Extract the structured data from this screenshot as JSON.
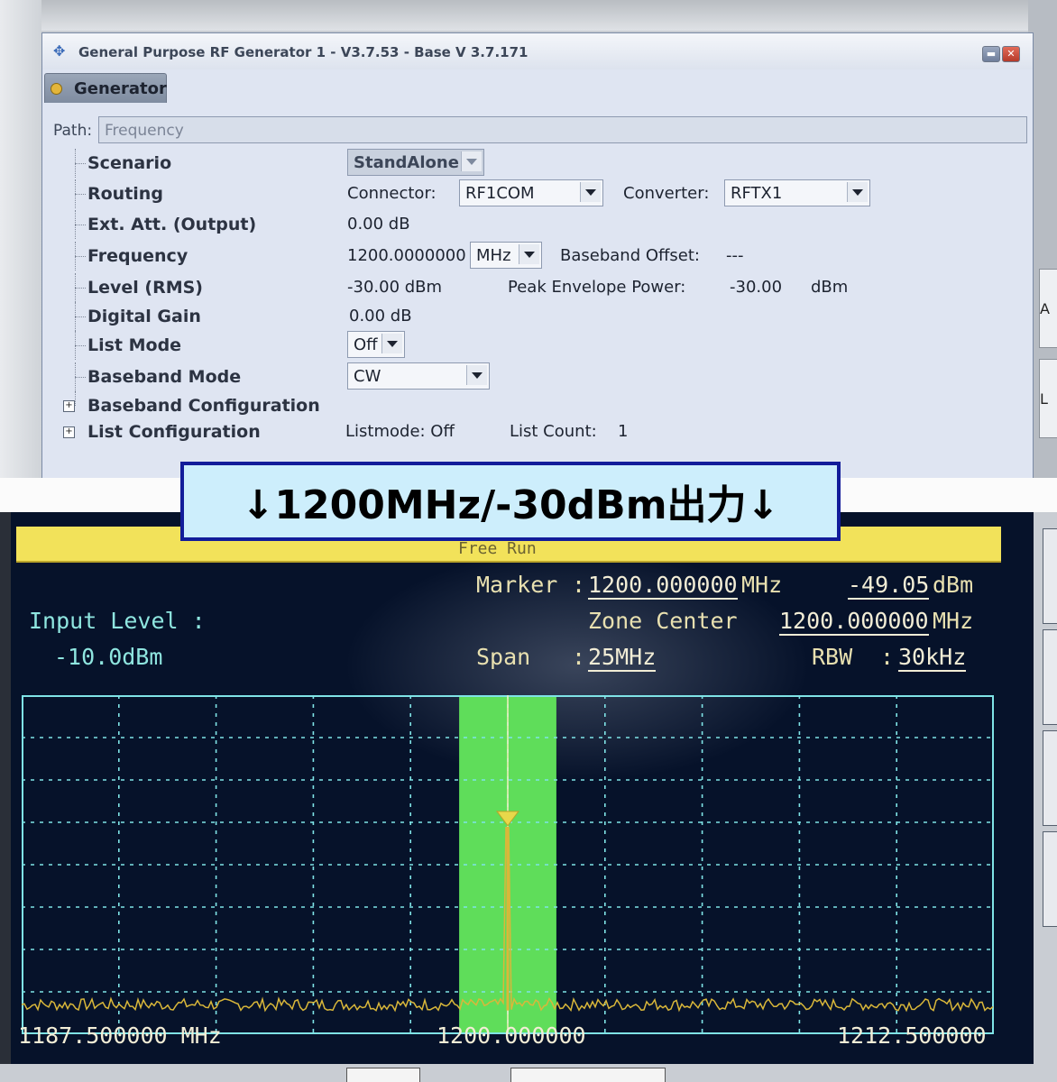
{
  "generator": {
    "window_title": "General Purpose RF Generator 1 - V3.7.53 - Base V 3.7.171",
    "tab_label": "Generator",
    "path_label": "Path:",
    "path_value": "Frequency",
    "rows": {
      "scenario": {
        "label": "Scenario",
        "value": "StandAlone"
      },
      "routing": {
        "label": "Routing",
        "connector_label": "Connector:",
        "connector_value": "RF1COM",
        "converter_label": "Converter:",
        "converter_value": "RFTX1"
      },
      "ext_att": {
        "label": "Ext. Att. (Output)",
        "value": "0.00 dB"
      },
      "frequency": {
        "label": "Frequency",
        "value": "1200.0000000",
        "unit": "MHz",
        "baseband_offset_label": "Baseband Offset:",
        "baseband_offset_value": "---"
      },
      "level": {
        "label": "Level (RMS)",
        "value": "-30.00 dBm",
        "pep_label": "Peak Envelope Power:",
        "pep_value": "-30.00",
        "pep_unit": "dBm"
      },
      "digital_gain": {
        "label": "Digital Gain",
        "value": "0.00 dB"
      },
      "list_mode": {
        "label": "List Mode",
        "value": "Off"
      },
      "baseband_mode": {
        "label": "Baseband Mode",
        "value": "CW"
      },
      "baseband_config": {
        "label": "Baseband Configuration"
      },
      "list_config": {
        "label": "List Configuration",
        "listmode_text": "Listmode: Off",
        "list_count_label": "List Count:",
        "list_count_value": "1"
      }
    },
    "side_buttons": [
      "A",
      "L"
    ]
  },
  "banner": {
    "text": "↓1200MHz/-30dBm出力↓"
  },
  "analyzer": {
    "status_text": "Free Run",
    "marker_label": "Marker",
    "marker_freq": "1200.000000",
    "marker_freq_unit": "MHz",
    "marker_level": "-49.05",
    "marker_level_unit": "dBm",
    "zone_center_label": "Zone Center",
    "zone_center_value": "1200.000000",
    "zone_center_unit": "MHz",
    "input_level_label": "Input Level :",
    "input_level_value": "-10.0dBm",
    "span_label": "Span",
    "span_value": "25MHz",
    "rbw_label": "RBW",
    "rbw_value": "30kHz",
    "freq_left": "1187.500000 MHz",
    "freq_center": "1200.000000",
    "freq_right": "1212.500000",
    "colors": {
      "zone_fill": "#5fdd5a",
      "trace": "#d9b73a",
      "grid": "#7fe3e6",
      "background": "#06122a"
    }
  },
  "chart_data": {
    "type": "line",
    "title": "",
    "xlabel": "",
    "ylabel": "",
    "xlim": [
      1187.5,
      1212.5
    ],
    "ylim": [
      -110,
      -10
    ],
    "x": [
      1187.5,
      1190,
      1192.5,
      1195,
      1197.5,
      1199.9,
      1200,
      1200.1,
      1202.5,
      1205,
      1207.5,
      1210,
      1212.5
    ],
    "series": [
      {
        "values": [
          -103,
          -103,
          -103,
          -103,
          -103,
          -103,
          -49.05,
          -103,
          -103,
          -103,
          -103,
          -103,
          -103
        ]
      }
    ],
    "marker": {
      "x": 1200.0,
      "y": -49.05
    },
    "zone": {
      "center": 1200.0,
      "width_mhz": 2.5
    },
    "grid": true
  }
}
